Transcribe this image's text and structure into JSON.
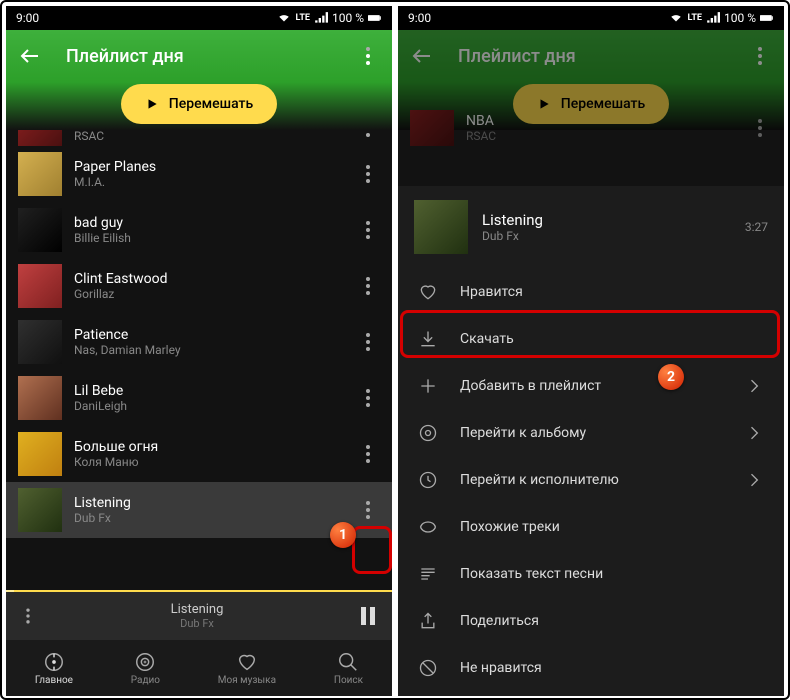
{
  "status": {
    "time": "9:00",
    "lte": "LTE",
    "battery": "100 %"
  },
  "header": {
    "title": "Плейлист дня"
  },
  "shuffle": {
    "label": "Перемешать"
  },
  "tracks": [
    {
      "title": "NBA",
      "artist": "RSAC"
    },
    {
      "title": "Paper Planes",
      "artist": "M.I.A."
    },
    {
      "title": "bad guy",
      "artist": "Billie Eilish"
    },
    {
      "title": "Clint Eastwood",
      "artist": "Gorillaz"
    },
    {
      "title": "Patience",
      "artist": "Nas, Damian Marley"
    },
    {
      "title": "Lil Bebe",
      "artist": "DaniLeigh"
    },
    {
      "title": "Больше огня",
      "artist": "Коля Маню"
    },
    {
      "title": "Listening",
      "artist": "Dub Fx"
    }
  ],
  "mini": {
    "title": "Listening",
    "artist": "Dub Fx"
  },
  "nav": {
    "home": "Главное",
    "radio": "Радио",
    "music": "Моя музыка",
    "search": "Поиск"
  },
  "sheet": {
    "title": "Listening",
    "artist": "Dub Fx",
    "duration": "3:27",
    "like": "Нравится",
    "download": "Скачать",
    "add": "Добавить в плейлист",
    "album": "Перейти к альбому",
    "artist_link": "Перейти к исполнителю",
    "similar": "Похожие треки",
    "lyrics": "Показать текст песни",
    "share": "Поделиться",
    "dislike": "Не нравится"
  },
  "callouts": {
    "one": "1",
    "two": "2"
  }
}
